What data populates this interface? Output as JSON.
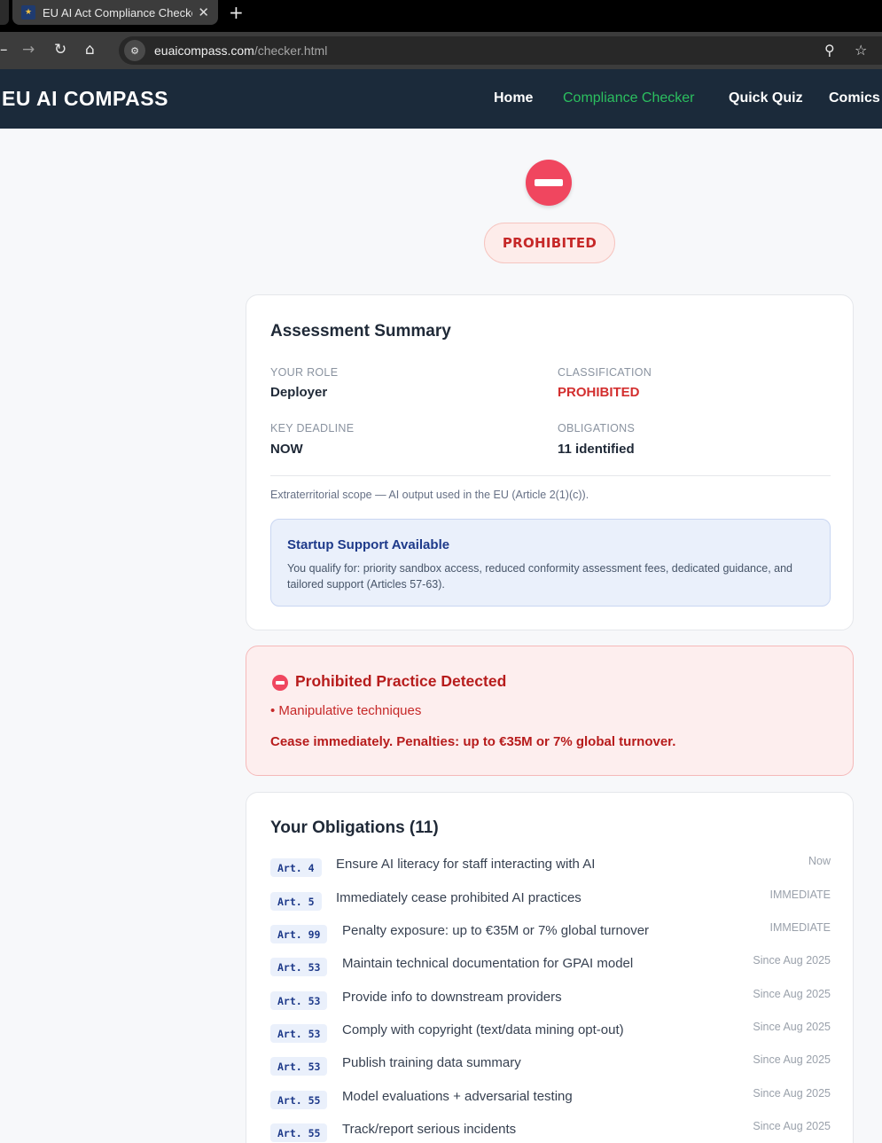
{
  "browser": {
    "tab_title": "EU AI Act Compliance Checker |",
    "url_host": "euaicompass.com",
    "url_path": "/checker.html"
  },
  "header": {
    "logo": "EU AI COMPASS",
    "nav": [
      "Home",
      "Compliance Checker",
      "Quick Quiz",
      "Comics"
    ],
    "active_nav": "Compliance Checker"
  },
  "status": {
    "label": "PROHIBITED",
    "color": "#f0465f"
  },
  "summary": {
    "title": "Assessment Summary",
    "role_label": "YOUR ROLE",
    "role_value": "Deployer",
    "class_label": "CLASSIFICATION",
    "class_value": "PROHIBITED",
    "deadline_label": "KEY DEADLINE",
    "deadline_value": "NOW",
    "oblig_label": "OBLIGATIONS",
    "oblig_value": "11 identified",
    "scope_note": "Extraterritorial scope — AI output used in the EU (Article 2(1)(c)).",
    "support_title": "Startup Support Available",
    "support_text": "You qualify for: priority sandbox access, reduced conformity assessment fees, dedicated guidance, and tailored support (Articles 57-63)."
  },
  "prohibited": {
    "title": "Prohibited Practice Detected",
    "item": "• Manipulative techniques",
    "warning": "Cease immediately. Penalties: up to €35M or 7% global turnover."
  },
  "obligations": {
    "title": "Your Obligations (11)",
    "items": [
      {
        "art": "Art. 4",
        "text": "Ensure AI literacy for staff interacting with AI",
        "when": "Now"
      },
      {
        "art": "Art. 5",
        "text": "Immediately cease prohibited AI practices",
        "when": "IMMEDIATE"
      },
      {
        "art": "Art. 99",
        "text": "Penalty exposure: up to €35M or 7% global turnover",
        "when": "IMMEDIATE"
      },
      {
        "art": "Art. 53",
        "text": "Maintain technical documentation for GPAI model",
        "when": "Since Aug 2025"
      },
      {
        "art": "Art. 53",
        "text": "Provide info to downstream providers",
        "when": "Since Aug 2025"
      },
      {
        "art": "Art. 53",
        "text": "Comply with copyright (text/data mining opt-out)",
        "when": "Since Aug 2025"
      },
      {
        "art": "Art. 53",
        "text": "Publish training data summary",
        "when": "Since Aug 2025"
      },
      {
        "art": "Art. 55",
        "text": "Model evaluations + adversarial testing",
        "when": "Since Aug 2025"
      },
      {
        "art": "Art. 55",
        "text": "Track/report serious incidents",
        "when": "Since Aug 2025"
      }
    ]
  }
}
